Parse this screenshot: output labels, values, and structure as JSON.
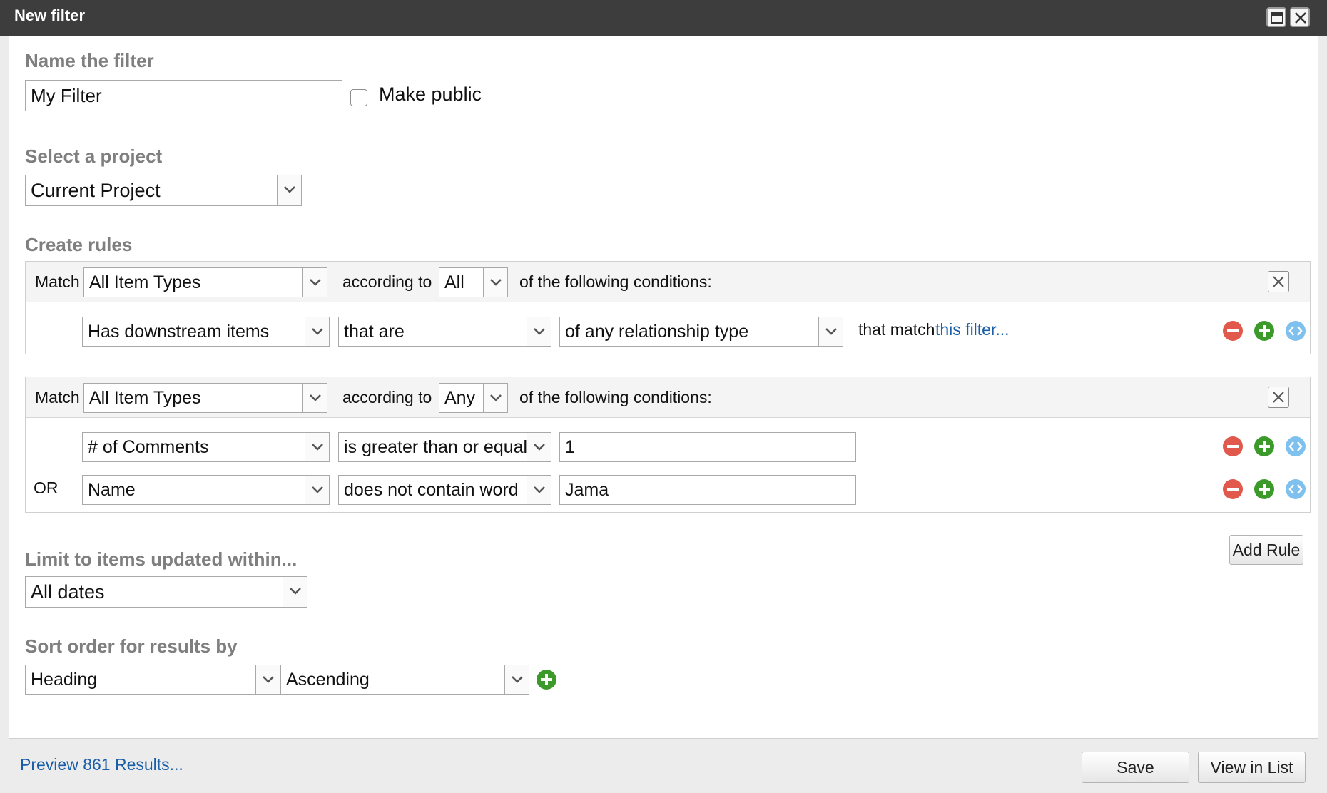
{
  "window": {
    "title": "New filter",
    "maximize_icon": "maximize-icon",
    "close_icon": "close-icon"
  },
  "name_section": {
    "label": "Name the filter",
    "value": "My Filter",
    "make_public_label": "Make public",
    "make_public_checked": false
  },
  "project_section": {
    "label": "Select a project",
    "selected": "Current Project"
  },
  "rules_section": {
    "label": "Create rules",
    "rule_sets": [
      {
        "match_label": "Match",
        "item_type": "All Item Types",
        "according_label": "according to",
        "according_value": "All",
        "conditions_label": "of the following conditions:",
        "conditions": [
          {
            "prefix": "",
            "field": "Has downstream items",
            "operator": "that are",
            "value": "of any relationship type",
            "suffix": "that match",
            "link": "this filter..."
          }
        ]
      },
      {
        "match_label": "Match",
        "item_type": "All Item Types",
        "according_label": "according to",
        "according_value": "Any",
        "conditions_label": "of the following conditions:",
        "conditions": [
          {
            "prefix": "",
            "field": "# of Comments",
            "operator": "is greater than or equal",
            "value": "1"
          },
          {
            "prefix": "OR",
            "field": "Name",
            "operator": "does not contain word",
            "value": "Jama"
          }
        ]
      }
    ],
    "add_rule_label": "Add Rule"
  },
  "limit_section": {
    "label": "Limit to items updated within...",
    "selected": "All dates"
  },
  "sort_section": {
    "label": "Sort order for results by",
    "field": "Heading",
    "direction": "Ascending"
  },
  "footer": {
    "preview_link": "Preview 861 Results...",
    "save_label": "Save",
    "view_list_label": "View in List"
  },
  "colors": {
    "titlebar": "#3d3d3d",
    "section_label": "#7f7f7f",
    "link": "#1a5ea8",
    "remove_icon": "#e0594c",
    "add_icon": "#3c9a2b",
    "move_icon": "#7ec1ee"
  }
}
